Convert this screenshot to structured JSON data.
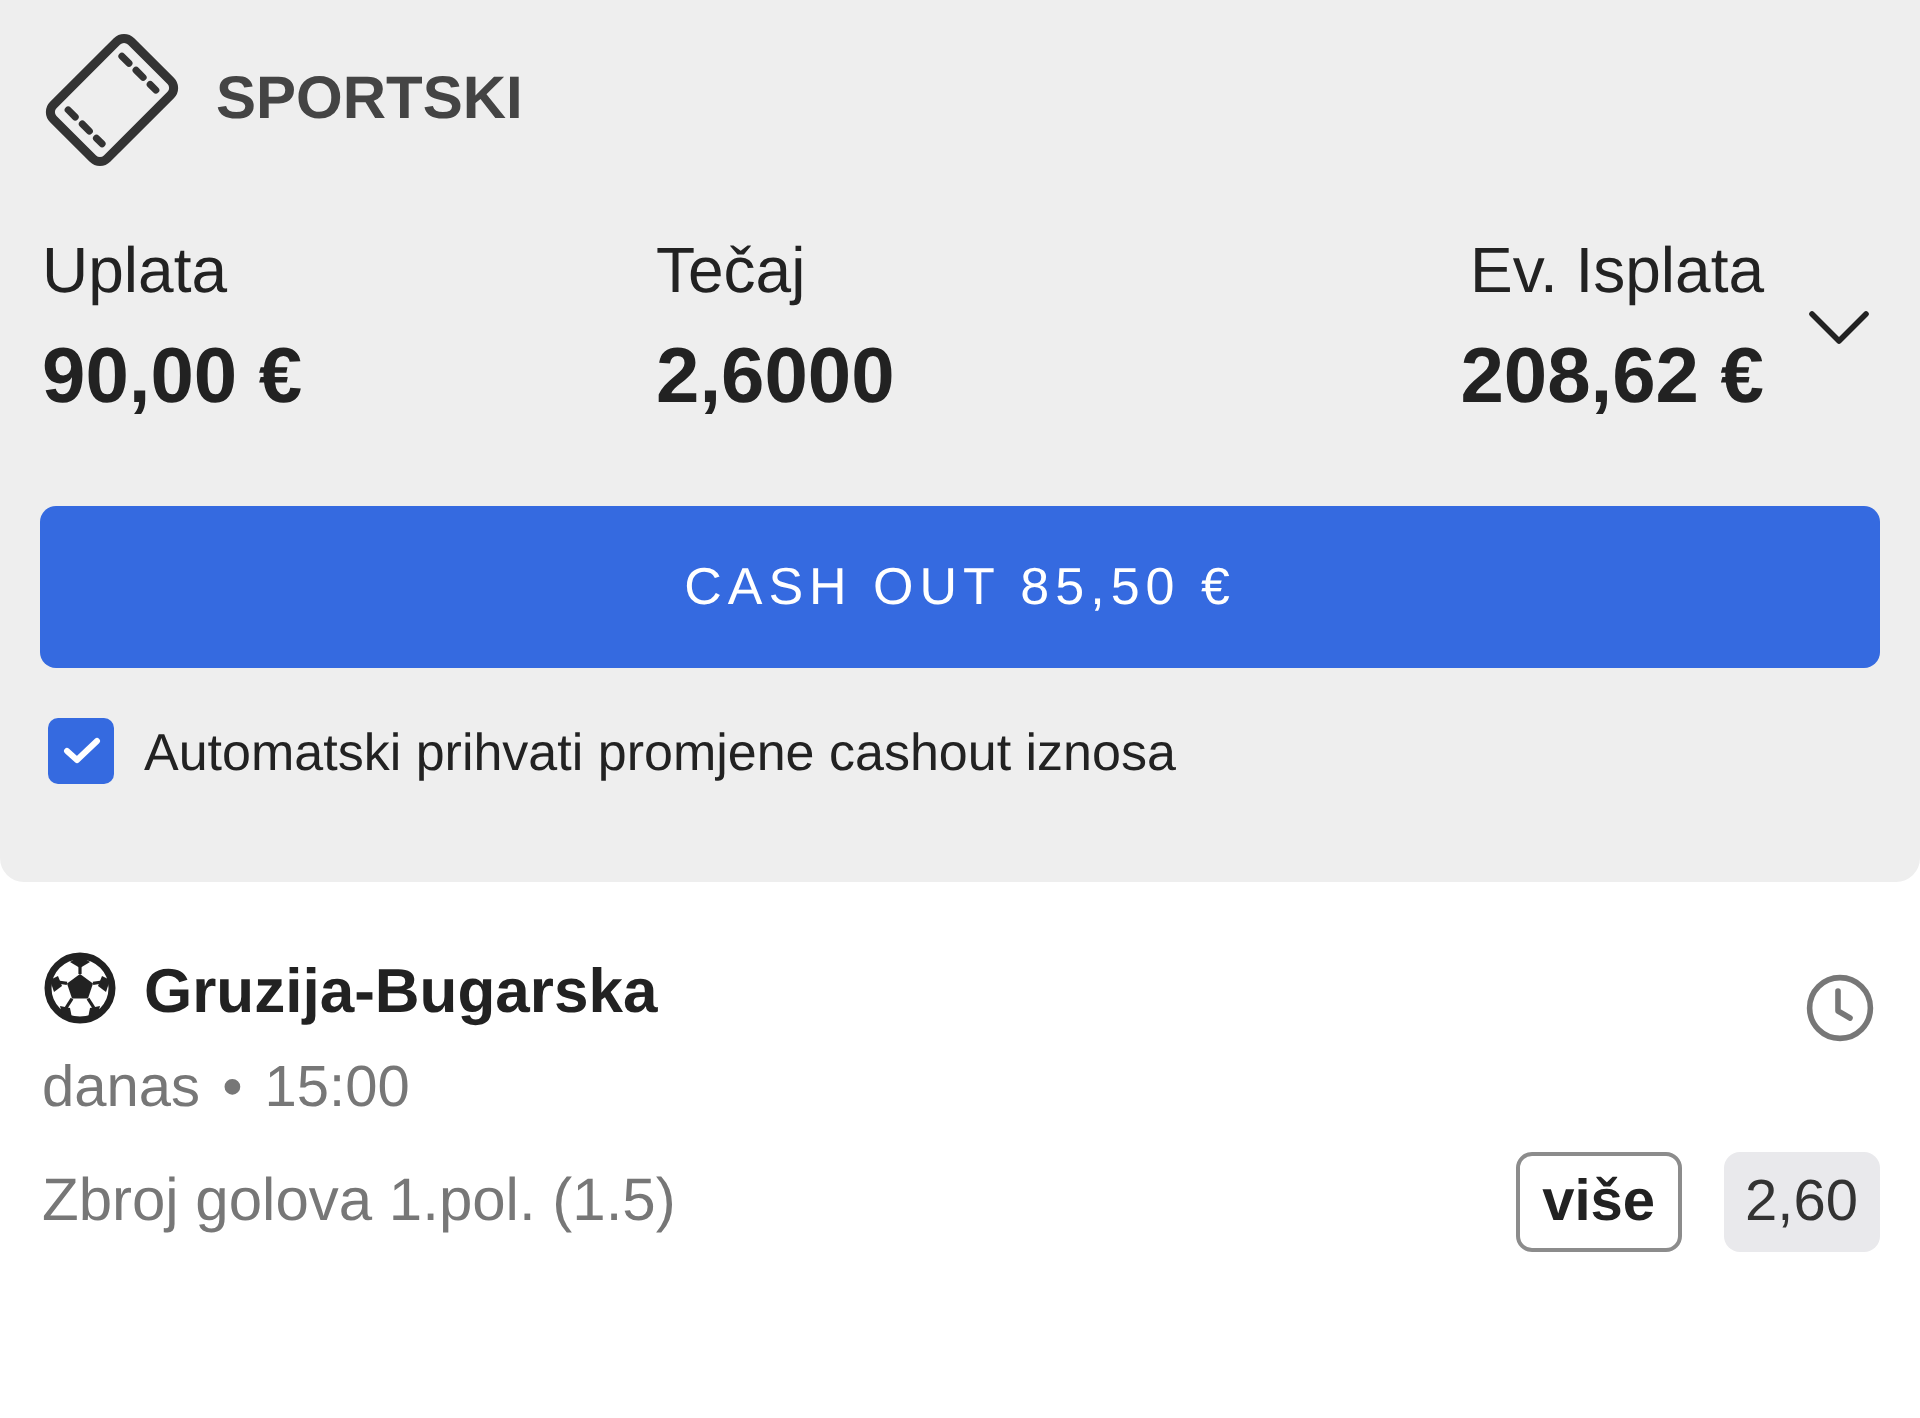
{
  "header": {
    "title": "SPORTSKI"
  },
  "summary": {
    "expanded": false,
    "items": [
      {
        "label": "Uplata",
        "value": "90,00 €"
      },
      {
        "label": "Tečaj",
        "value": "2,6000"
      },
      {
        "label": "Ev. Isplata",
        "value": "208,62 €"
      }
    ]
  },
  "cashout_button": {
    "label": "CASH OUT 85,50 €"
  },
  "auto_accept": {
    "label": "Automatski prihvati promjene cashout iznosa",
    "checked": true
  },
  "match": {
    "title": "Gruzija-Bugarska",
    "when": "danas • 15:00",
    "market": "Zbroj golova 1.pol. (1.5)",
    "pick": "više",
    "odds": "2,60"
  }
}
